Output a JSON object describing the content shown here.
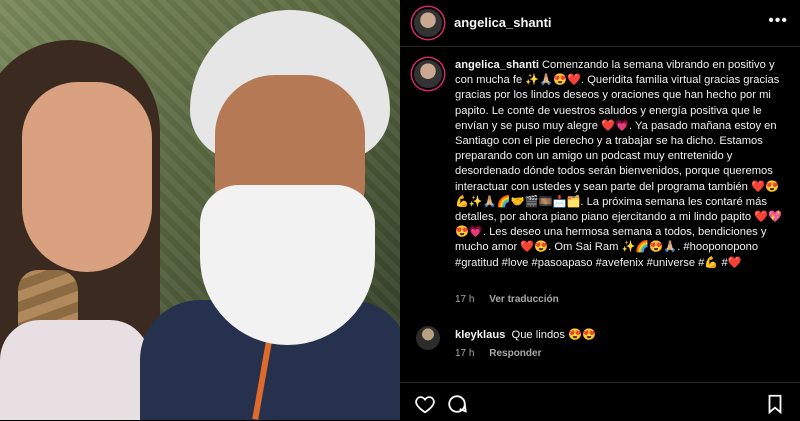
{
  "post": {
    "username": "angelica_shanti",
    "caption": "Comenzando la semana vibrando en positivo y con mucha fe ✨🙏🏼😍❤️. Queridita familia virtual gracias gracias gracias por los lindos deseos y oraciones que han hecho por mi papito. Le conté de vuestros saludos y energía positiva que le envían y se puso muy alegre ❤️💗. Ya pasado mañana estoy en Santiago con el pie derecho y a trabajar se ha dicho. Estamos preparando con un amigo un podcast muy entretenido y desordenado dónde todos serán bienvenidos, porque queremos interactuar con ustedes y sean parte del programa también ❤️😍💪✨🙏🏼🌈🤝🎬🎞️📩🗂️. La próxima semana les contaré más detalles, por ahora piano piano ejercitando a mi lindo papito ❤️💖😍💗. Les deseo una hermosa semana a todos, bendiciones y mucho amor ❤️😍. Om Sai Ram ✨🌈😍🙏🏼. #hooponopono #gratitud #love #pasoapaso #avefenix #universe #💪 #❤️",
    "time": "17 h",
    "see_translation": "Ver traducción"
  },
  "comment": {
    "username": "kleyklaus",
    "text": "Que lindos 😍😍",
    "time": "17 h",
    "reply": "Responder"
  },
  "icons": [
    "more-icon",
    "heart-icon",
    "comment-icon",
    "bookmark-icon"
  ],
  "colors": {
    "background": "#000000",
    "text": "#f5f5f5",
    "muted": "#a8a8a8",
    "story_ring": "#d22a6b"
  }
}
